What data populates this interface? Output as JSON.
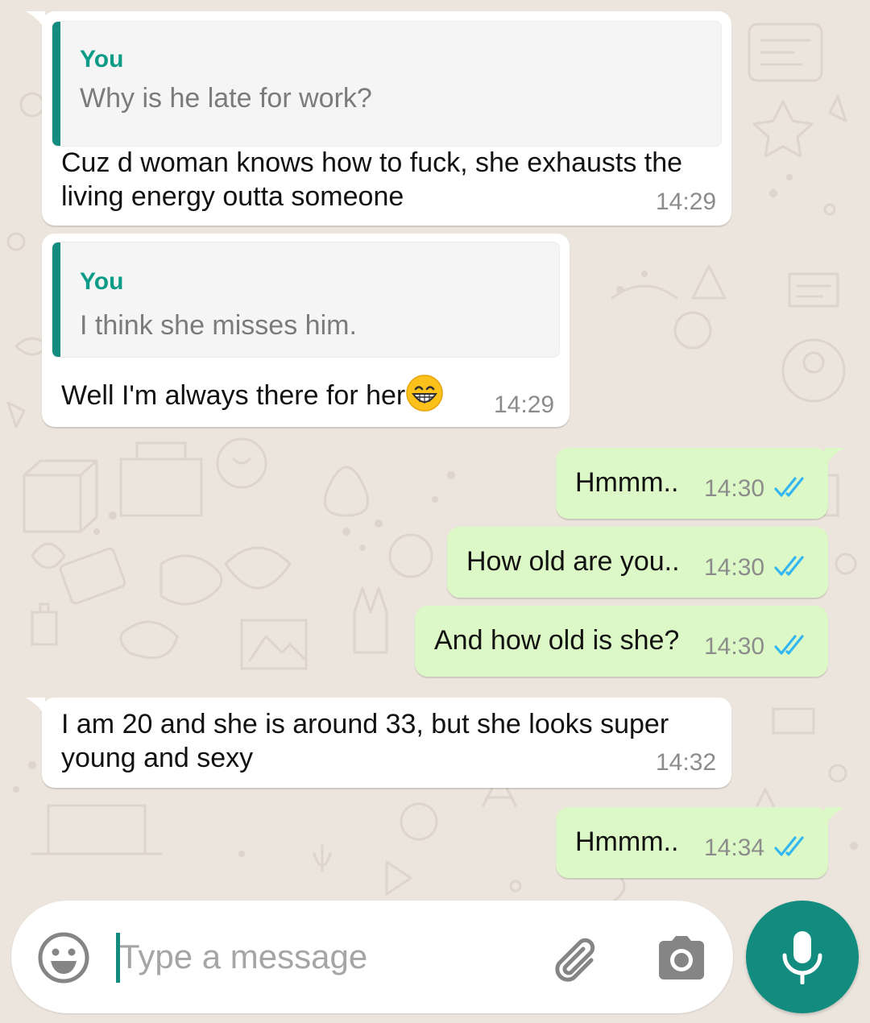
{
  "conversation": {
    "messages": [
      {
        "direction": "incoming",
        "quote_author": "You",
        "quote_text": "Why is he late for work?",
        "lines": [
          "Cuz d woman knows how to fuck, she exhausts the",
          "living energy outta someone"
        ],
        "time": "14:29"
      },
      {
        "direction": "incoming",
        "quote_author": "You",
        "quote_text": "I think she misses him.",
        "lines": [
          "Well I'm always there for her"
        ],
        "emoji": "grinning-face-with-smiling-eyes",
        "time": "14:29"
      },
      {
        "direction": "outgoing",
        "lines": [
          "Hmmm.."
        ],
        "time": "14:30",
        "status": "read"
      },
      {
        "direction": "outgoing",
        "lines": [
          "How old are you.."
        ],
        "time": "14:30",
        "status": "read"
      },
      {
        "direction": "outgoing",
        "lines": [
          "And how old is she?"
        ],
        "time": "14:30",
        "status": "read"
      },
      {
        "direction": "incoming",
        "lines": [
          "I am 20 and she is around 33, but she looks super",
          "young and sexy"
        ],
        "time": "14:32"
      },
      {
        "direction": "outgoing",
        "lines": [
          "Hmmm.."
        ],
        "time": "14:34",
        "status": "read"
      }
    ]
  },
  "composer": {
    "placeholder": "Type a message",
    "value": "",
    "emoji_icon": "smiley-icon",
    "attach_icon": "paperclip-icon",
    "camera_icon": "camera-icon",
    "mic_icon": "microphone-icon"
  },
  "colors": {
    "background": "#ece5dd",
    "incoming_bubble": "#ffffff",
    "outgoing_bubble": "#dcf8c6",
    "accent": "#128c7e",
    "quote_author": "#0b9b87",
    "read_ticks": "#34b7f1"
  }
}
